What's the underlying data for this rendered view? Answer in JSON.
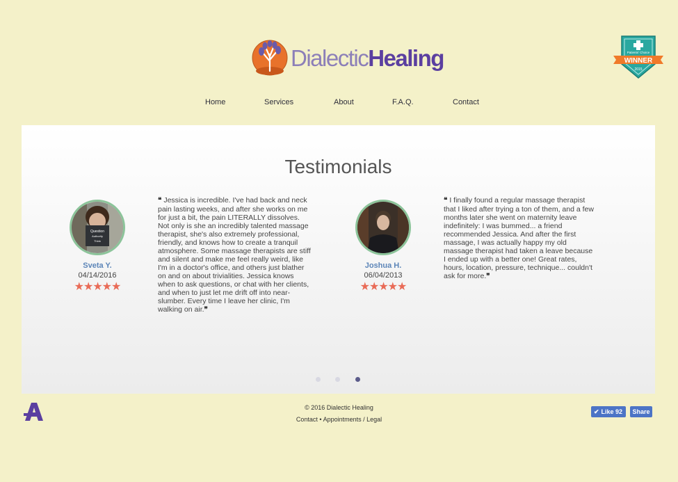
{
  "brand": {
    "name_part1": "Dialectic",
    "name_part2": "Healing",
    "colors": {
      "background": "#f4f1c9",
      "primary": "#5b3fa0",
      "accent": "#e8722b",
      "badge": "#2aa8a0"
    }
  },
  "badge": {
    "label": "WINNER",
    "sublabel": "Patients' Choice",
    "year": "2015"
  },
  "nav": {
    "items": [
      {
        "label": "Home"
      },
      {
        "label": "Services"
      },
      {
        "label": "About"
      },
      {
        "label": "F.A.Q."
      },
      {
        "label": "Contact"
      }
    ]
  },
  "testimonials": {
    "title": "Testimonials",
    "items": [
      {
        "name": "Sveta Y.",
        "date": "04/14/2016",
        "rating": 5,
        "stars": "★★★★★",
        "quote": "Jessica is incredible. I've had back and neck pain lasting weeks, and after she works on me for just a bit, the pain LITERALLY dissolves. Not only is she an incredibly talented massage therapist, she's also extremely professional, friendly, and knows how to create a tranquil atmosphere. Some massage therapists are stiff and silent and make me feel really weird, like I'm in a doctor's office, and others just blather on and on about trivialities. Jessica knows when to ask questions, or chat with her clients, and when to just let me drift off into near-slumber. Every time I leave her clinic, I'm walking on air.",
        "book_text": "Question Authority Think"
      },
      {
        "name": "Joshua H.",
        "date": "06/04/2013",
        "rating": 5,
        "stars": "★★★★★",
        "quote": "I finally found a regular massage therapist that I liked after trying a ton of them, and a few months later she went on maternity leave indefinitely: I was bummed... a friend recommended Jessica. And after the first massage, I was actually happy my old massage therapist had taken a leave because I ended up with a better one! Great rates, hours, location, pressure, technique... couldn't ask for more."
      }
    ],
    "pagination": {
      "count": 3,
      "active": 3
    }
  },
  "quote_marks": {
    "open": "❝",
    "close": "❞"
  },
  "footer": {
    "copyright": "© 2016 Dialectic Healing",
    "links": [
      "Contact",
      "Appointments / Legal"
    ],
    "separator": "•",
    "logo_letter": "A"
  },
  "facebook": {
    "like_label": "Like 92",
    "share_label": "Share"
  }
}
